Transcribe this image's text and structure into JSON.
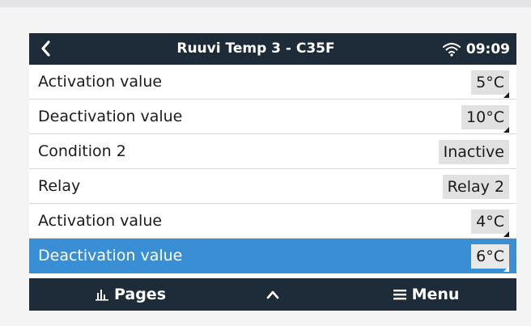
{
  "header": {
    "title": "Ruuvi Temp 3 - C35F",
    "time": "09:09",
    "back_icon": "chevron-left-icon",
    "wifi_icon": "wifi-icon"
  },
  "rows": [
    {
      "label": "Activation value",
      "value": "5°C",
      "selected": false
    },
    {
      "label": "Deactivation value",
      "value": "10°C",
      "selected": false
    },
    {
      "label": "Condition 2",
      "value": "Inactive",
      "selected": false
    },
    {
      "label": "Relay",
      "value": "Relay 2",
      "selected": false
    },
    {
      "label": "Activation value",
      "value": "4°C",
      "selected": false
    },
    {
      "label": "Deactivation value",
      "value": "6°C",
      "selected": true
    }
  ],
  "footer": {
    "pages_label": "Pages",
    "pages_icon": "bar-chart-icon",
    "up_icon": "chevron-up-icon",
    "menu_label": "Menu",
    "menu_icon": "hamburger-icon"
  },
  "colors": {
    "header_bg": "#1e2c39",
    "selected_row": "#3a8ed4",
    "value_box": "#e1e1e1"
  }
}
